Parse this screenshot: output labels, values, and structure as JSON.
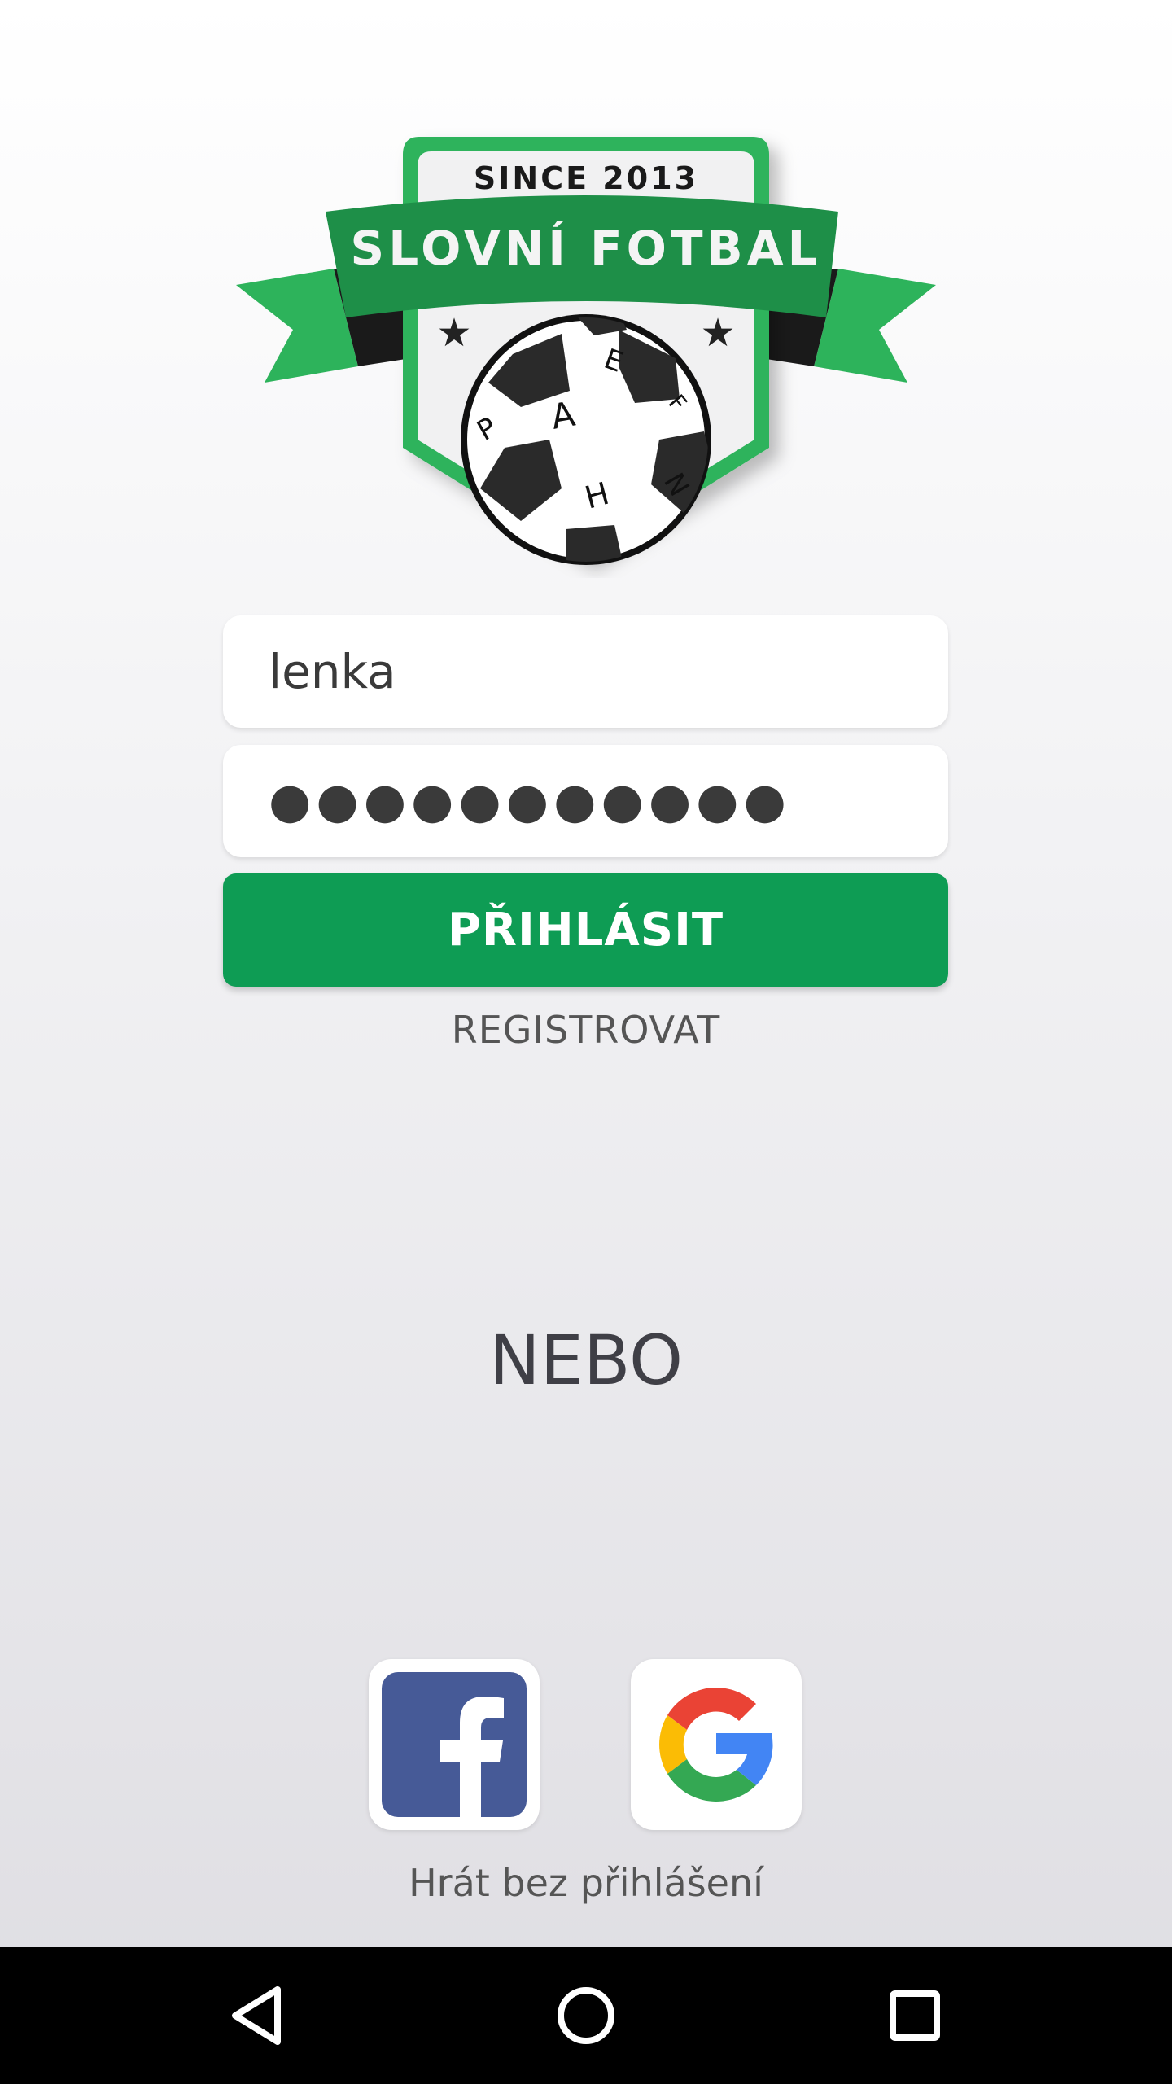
{
  "logo": {
    "since_text": "SINCE 2013",
    "title_text": "SLOVNÍ FOTBAL",
    "ball_letters": [
      "E",
      "F",
      "P",
      "A",
      "N",
      "H"
    ]
  },
  "form": {
    "username_value": "lenka",
    "password_value": "●●●●●●●●●●●",
    "login_label": "PŘIHLÁSIT",
    "register_label": "REGISTROVAT"
  },
  "divider": {
    "or_label": "NEBO"
  },
  "social": {
    "facebook_icon": "facebook-logo-icon",
    "google_icon": "google-logo-icon",
    "guest_label": "Hrát bez přihlášení"
  },
  "colors": {
    "brand_green": "#0e9c54",
    "logo_green": "#2db35b",
    "facebook_blue": "#465a97"
  },
  "navbar": {
    "back_icon": "back-triangle-icon",
    "home_icon": "home-circle-icon",
    "recents_icon": "recents-square-icon"
  }
}
